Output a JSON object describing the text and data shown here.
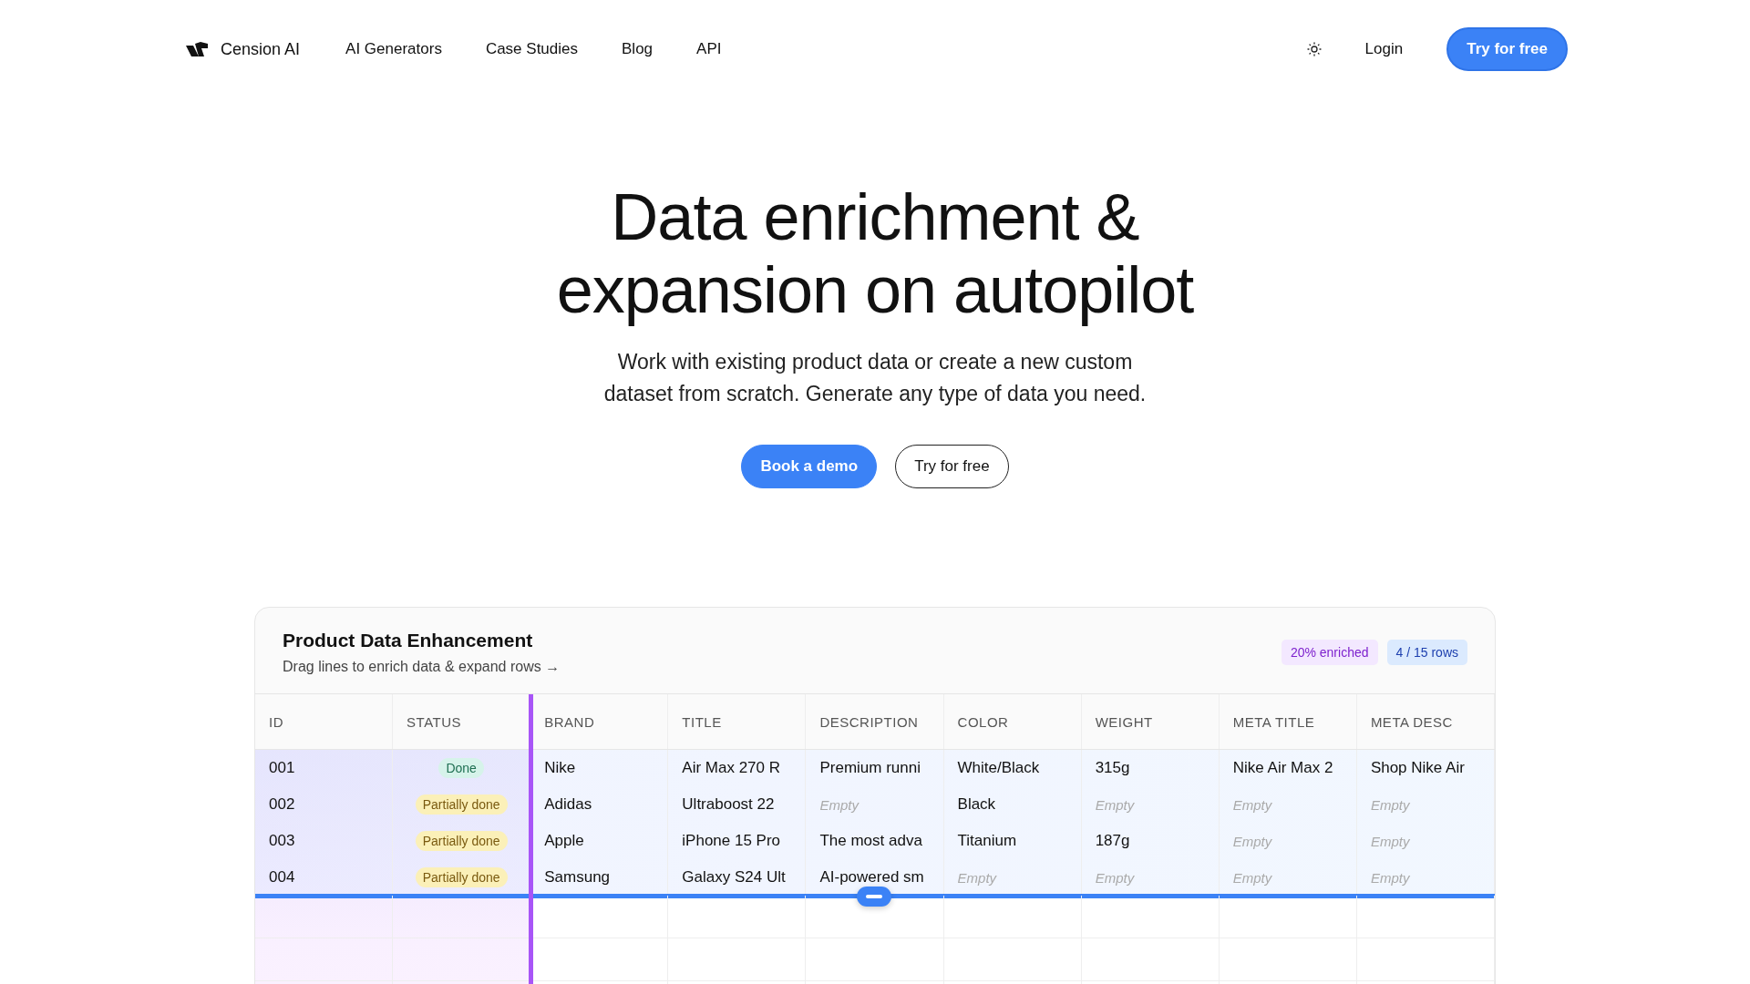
{
  "nav": {
    "brand": "Cension AI",
    "links": [
      "AI Generators",
      "Case Studies",
      "Blog",
      "API"
    ],
    "login": "Login",
    "cta": "Try for free"
  },
  "hero": {
    "title_lines": [
      "Data enrichment &",
      "expansion on autopilot"
    ],
    "subtitle_lines": [
      "Work with existing product data or create a new custom",
      "dataset from scratch. Generate any type of data you need."
    ],
    "primary_button": "Book a demo",
    "secondary_button": "Try for free"
  },
  "card": {
    "title": "Product Data Enhancement",
    "hint": "Drag lines to enrich data & expand rows →",
    "badges": [
      {
        "label": "20% enriched",
        "kind": "enriched"
      },
      {
        "label": "4 / 15 rows",
        "kind": "rows"
      }
    ],
    "columns": [
      "ID",
      "STATUS",
      "BRAND",
      "TITLE",
      "DESCRIPTION",
      "COLOR",
      "WEIGHT",
      "META TITLE",
      "META DESC"
    ],
    "rows": [
      {
        "cells": [
          {
            "text": "001",
            "kind": "id"
          },
          {
            "text": "Done",
            "kind": "done"
          },
          {
            "text": "Nike",
            "kind": "text"
          },
          {
            "text": "Air Max 270 R",
            "kind": "text"
          },
          {
            "text": "Premium runni",
            "kind": "text"
          },
          {
            "text": "White/Black",
            "kind": "text"
          },
          {
            "text": "315g",
            "kind": "text"
          },
          {
            "text": "Nike Air Max 2",
            "kind": "text"
          },
          {
            "text": "Shop Nike Air",
            "kind": "text"
          }
        ]
      },
      {
        "cells": [
          {
            "text": "002",
            "kind": "id"
          },
          {
            "text": "Partially done",
            "kind": "partial"
          },
          {
            "text": "Adidas",
            "kind": "text"
          },
          {
            "text": "Ultraboost 22",
            "kind": "text"
          },
          {
            "text": "Empty",
            "kind": "empty"
          },
          {
            "text": "Black",
            "kind": "text"
          },
          {
            "text": "Empty",
            "kind": "empty"
          },
          {
            "text": "Empty",
            "kind": "empty"
          },
          {
            "text": "Empty",
            "kind": "empty"
          }
        ]
      },
      {
        "cells": [
          {
            "text": "003",
            "kind": "id"
          },
          {
            "text": "Partially done",
            "kind": "partial"
          },
          {
            "text": "Apple",
            "kind": "text"
          },
          {
            "text": "iPhone 15 Pro",
            "kind": "text"
          },
          {
            "text": "The most adva",
            "kind": "text"
          },
          {
            "text": "Titanium",
            "kind": "text"
          },
          {
            "text": "187g",
            "kind": "text"
          },
          {
            "text": "Empty",
            "kind": "empty"
          },
          {
            "text": "Empty",
            "kind": "empty"
          }
        ]
      },
      {
        "cells": [
          {
            "text": "004",
            "kind": "id"
          },
          {
            "text": "Partially done",
            "kind": "partial"
          },
          {
            "text": "Samsung",
            "kind": "text"
          },
          {
            "text": "Galaxy S24 Ult",
            "kind": "text"
          },
          {
            "text": "AI-powered sm",
            "kind": "text"
          },
          {
            "text": "Empty",
            "kind": "empty"
          },
          {
            "text": "Empty",
            "kind": "empty"
          },
          {
            "text": "Empty",
            "kind": "empty"
          },
          {
            "text": "Empty",
            "kind": "empty"
          }
        ]
      }
    ]
  }
}
